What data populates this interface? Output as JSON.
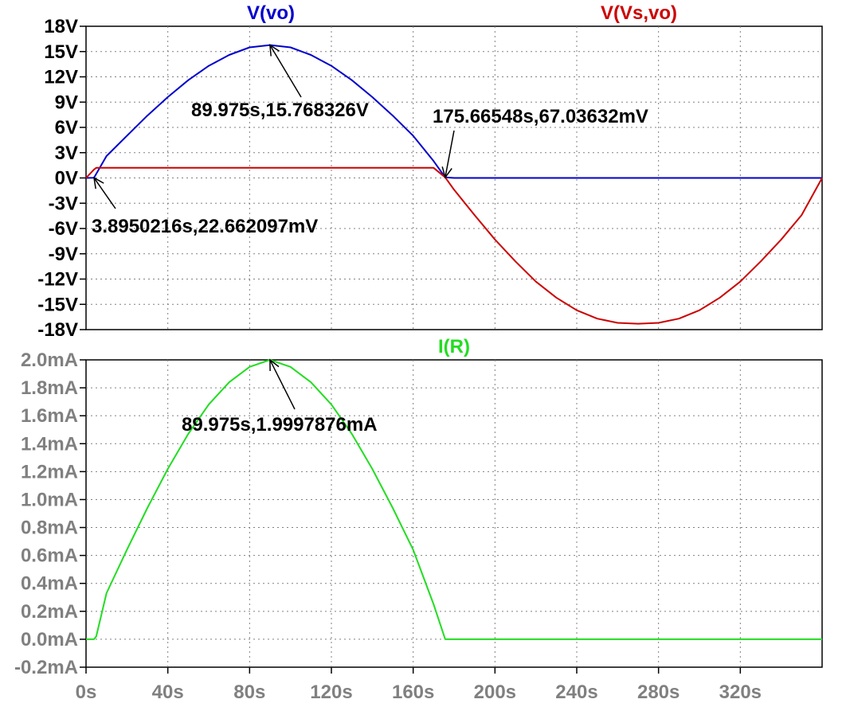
{
  "chart_data": [
    {
      "type": "line",
      "panel": "voltage",
      "xlim": [
        0,
        360
      ],
      "ylim": [
        -18,
        18
      ],
      "yticks": [
        "18V",
        "15V",
        "12V",
        "9V",
        "6V",
        "3V",
        "0V",
        "-3V",
        "-6V",
        "-9V",
        "-12V",
        "-15V",
        "-18V"
      ],
      "ytick_values": [
        18,
        15,
        12,
        9,
        6,
        3,
        0,
        -3,
        -6,
        -9,
        -12,
        -15,
        -18
      ],
      "grid": true,
      "series": [
        {
          "name": "V(vo)",
          "color": "#0000cc",
          "x": [
            0,
            3.9,
            10,
            20,
            30,
            40,
            50,
            60,
            70,
            80,
            89.975,
            100,
            110,
            120,
            130,
            140,
            150,
            160,
            170,
            175.67,
            180,
            200,
            240,
            280,
            320,
            360
          ],
          "y": [
            0,
            0.02,
            2.6,
            5.0,
            7.4,
            9.6,
            11.6,
            13.3,
            14.6,
            15.5,
            15.77,
            15.5,
            14.6,
            13.3,
            11.6,
            9.6,
            7.4,
            5.0,
            2.0,
            0.07,
            0,
            0,
            0,
            0,
            0,
            0
          ]
        },
        {
          "name": "V(Vs,vo)",
          "color": "#cc0000",
          "x": [
            0,
            3.9,
            5,
            20,
            60,
            100,
            140,
            170,
            175.67,
            180,
            190,
            200,
            210,
            220,
            230,
            240,
            250,
            260,
            270,
            280,
            290,
            300,
            310,
            320,
            330,
            340,
            350,
            360
          ],
          "y": [
            0,
            1.0,
            1.2,
            1.2,
            1.2,
            1.2,
            1.2,
            1.2,
            0.07,
            -1.4,
            -4.4,
            -7.3,
            -9.9,
            -12.3,
            -14.2,
            -15.7,
            -16.7,
            -17.2,
            -17.3,
            -17.2,
            -16.7,
            -15.7,
            -14.2,
            -12.3,
            -9.9,
            -7.3,
            -4.4,
            0
          ]
        }
      ],
      "annotations": [
        {
          "label": "89.975s,15.768326V",
          "x": 89.975,
          "y": 15.768
        },
        {
          "label": "175.66548s,67.03632mV",
          "x": 175.665,
          "y": 0.067
        },
        {
          "label": "3.8950216s,22.662097mV",
          "x": 3.895,
          "y": 0.0227
        }
      ]
    },
    {
      "type": "line",
      "panel": "current",
      "xlim": [
        0,
        360
      ],
      "ylim": [
        -0.2,
        2.0
      ],
      "xlabel": "",
      "xticks": [
        "0s",
        "40s",
        "80s",
        "120s",
        "160s",
        "200s",
        "240s",
        "280s",
        "320s"
      ],
      "xtick_values": [
        0,
        40,
        80,
        120,
        160,
        200,
        240,
        280,
        320
      ],
      "yticks": [
        "2.0mA",
        "1.8mA",
        "1.6mA",
        "1.4mA",
        "1.2mA",
        "1.0mA",
        "0.8mA",
        "0.6mA",
        "0.4mA",
        "0.2mA",
        "0.0mA",
        "-0.2mA"
      ],
      "ytick_values": [
        2.0,
        1.8,
        1.6,
        1.4,
        1.2,
        1.0,
        0.8,
        0.6,
        0.4,
        0.2,
        0.0,
        -0.2
      ],
      "grid": true,
      "series": [
        {
          "name": "I(R)",
          "color": "#22dd22",
          "x": [
            0,
            3.9,
            5,
            10,
            20,
            30,
            40,
            50,
            60,
            70,
            80,
            89.975,
            100,
            110,
            120,
            130,
            140,
            150,
            160,
            170,
            175.67,
            180,
            220,
            260,
            300,
            340,
            360
          ],
          "y": [
            0,
            0,
            0.02,
            0.33,
            0.64,
            0.94,
            1.22,
            1.47,
            1.68,
            1.84,
            1.95,
            2.0,
            1.95,
            1.84,
            1.68,
            1.47,
            1.22,
            0.94,
            0.64,
            0.25,
            0.0,
            0,
            0,
            0,
            0,
            0,
            0
          ]
        }
      ],
      "annotations": [
        {
          "label": "89.975s,1.9997876mA",
          "x": 89.975,
          "y": 1.99979
        }
      ]
    }
  ]
}
